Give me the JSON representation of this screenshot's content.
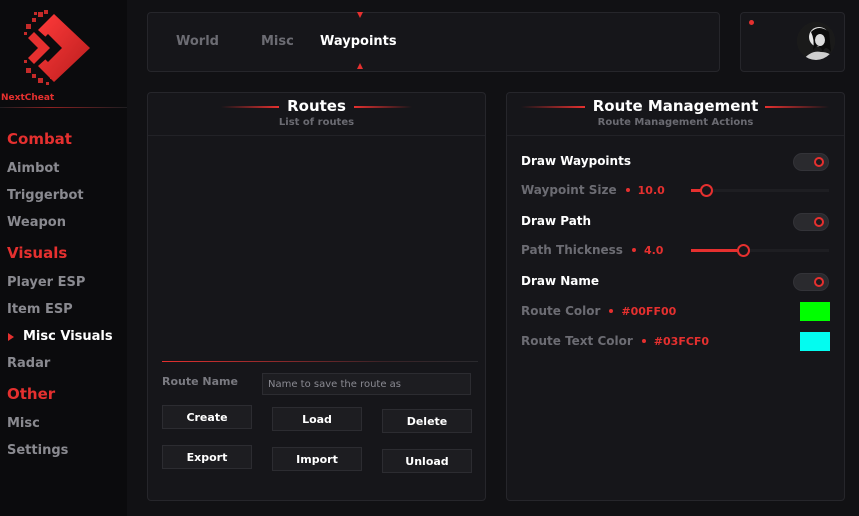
{
  "brand": {
    "name": "NextCheat",
    "accent": "#e5302f"
  },
  "sidebar": {
    "sections": [
      {
        "title": "Combat",
        "items": [
          "Aimbot",
          "Triggerbot",
          "Weapon"
        ]
      },
      {
        "title": "Visuals",
        "items": [
          "Player ESP",
          "Item ESP",
          "Misc Visuals",
          "Radar"
        ]
      },
      {
        "title": "Other",
        "items": [
          "Misc",
          "Settings"
        ]
      }
    ],
    "active_item": "Misc Visuals"
  },
  "tabs": {
    "items": [
      "World",
      "Misc",
      "Waypoints"
    ],
    "active": "Waypoints"
  },
  "routes": {
    "title": "Routes",
    "subtitle": "List of routes",
    "name_label": "Route Name",
    "name_placeholder": "Name to save the route as",
    "buttons": {
      "create": "Create",
      "load": "Load",
      "delete": "Delete",
      "export": "Export",
      "import": "Import",
      "unload": "Unload"
    }
  },
  "management": {
    "title": "Route Management",
    "subtitle": "Route Management Actions",
    "draw_waypoints": {
      "label": "Draw Waypoints",
      "enabled": true
    },
    "waypoint_size": {
      "label": "Waypoint Size",
      "value": "10.0",
      "fraction": 0.11
    },
    "draw_path": {
      "label": "Draw Path",
      "enabled": true
    },
    "path_thickness": {
      "label": "Path Thickness",
      "value": "4.0",
      "fraction": 0.38
    },
    "draw_name": {
      "label": "Draw Name",
      "enabled": true
    },
    "route_color": {
      "label": "Route Color",
      "value": "#00FF00",
      "color": "#00FF00"
    },
    "route_text_color": {
      "label": "Route Text Color",
      "value": "#03FCF0",
      "color": "#03FCF0"
    }
  }
}
